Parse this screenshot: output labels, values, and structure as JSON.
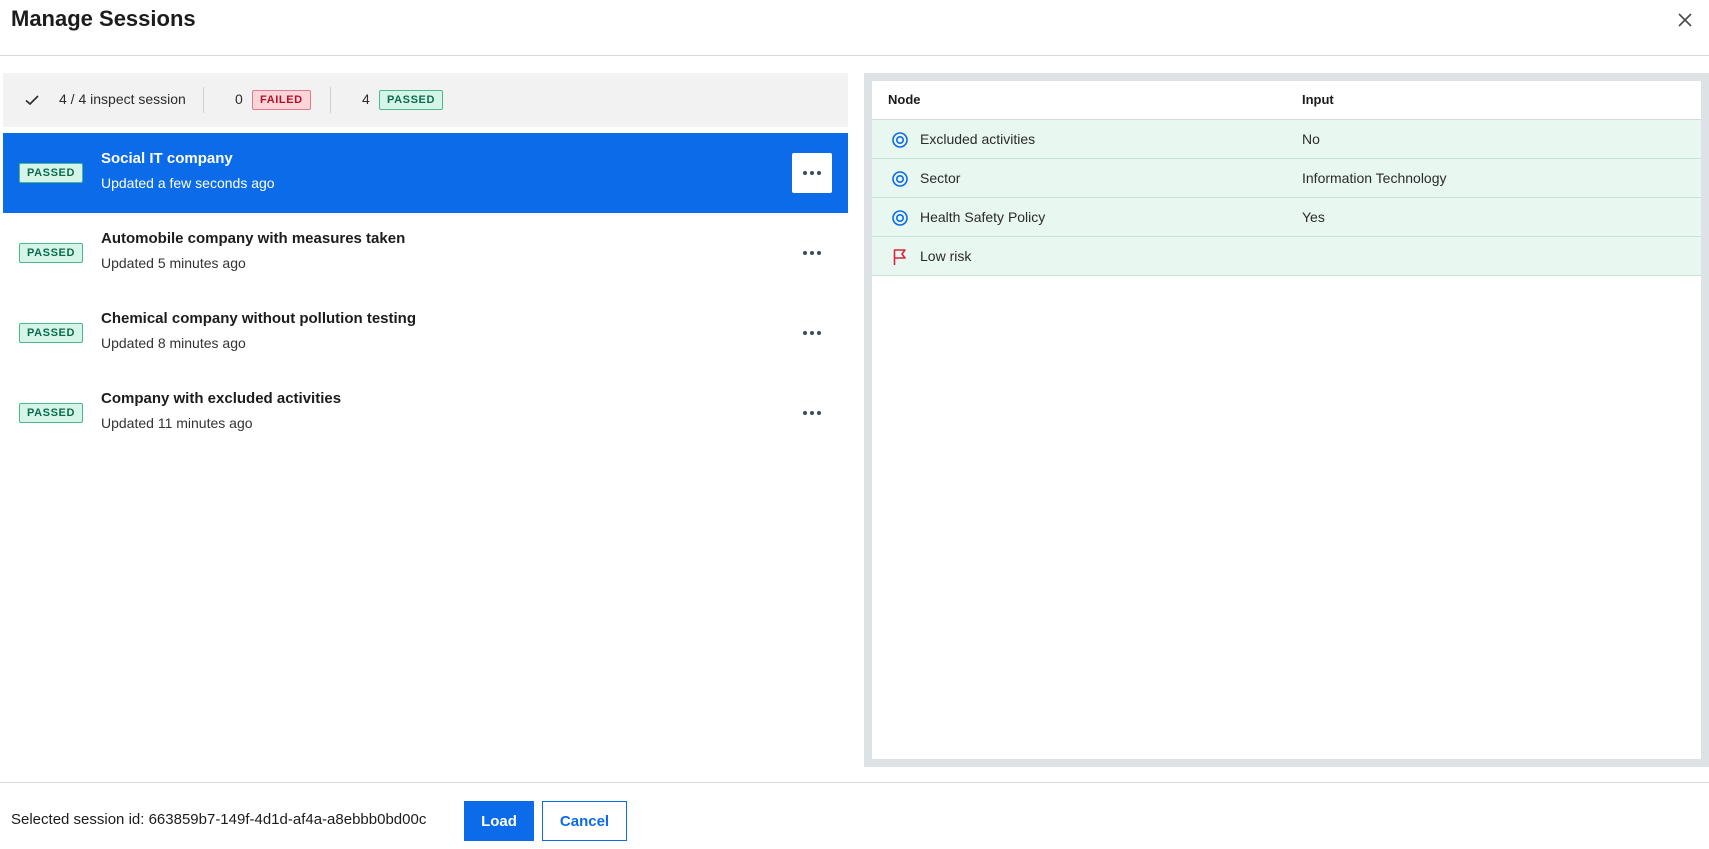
{
  "dialog": {
    "title": "Manage Sessions"
  },
  "summary": {
    "inspect_text": "4 / 4 inspect session",
    "failed_count": "0",
    "failed_label": "FAILED",
    "passed_count": "4",
    "passed_label": "PASSED"
  },
  "sessions": [
    {
      "status": "PASSED",
      "name": "Social IT company",
      "updated": "Updated a few seconds ago",
      "selected": true
    },
    {
      "status": "PASSED",
      "name": "Automobile company with measures taken",
      "updated": "Updated 5 minutes ago",
      "selected": false
    },
    {
      "status": "PASSED",
      "name": "Chemical company without pollution testing",
      "updated": "Updated 8 minutes ago",
      "selected": false
    },
    {
      "status": "PASSED",
      "name": "Company with excluded activities",
      "updated": "Updated 11 minutes ago",
      "selected": false
    }
  ],
  "table": {
    "col_node": "Node",
    "col_input": "Input",
    "rows": [
      {
        "icon": "target-icon",
        "node": "Excluded activities",
        "input": "No"
      },
      {
        "icon": "target-icon",
        "node": "Sector",
        "input": "Information Technology"
      },
      {
        "icon": "target-icon",
        "node": "Health Safety Policy",
        "input": "Yes"
      },
      {
        "icon": "flag-icon",
        "node": "Low risk",
        "input": ""
      }
    ]
  },
  "footer": {
    "selected_label": "Selected session id: 663859b7-149f-4d1d-af4a-a8ebbb0bd00c",
    "load_label": "Load",
    "cancel_label": "Cancel"
  },
  "colors": {
    "accent": "#0b6be8",
    "passed_bg": "#d6f5e9",
    "failed_bg": "#fbd6d9",
    "row_bg": "#e8f7f0",
    "flag": "#d7263d"
  }
}
